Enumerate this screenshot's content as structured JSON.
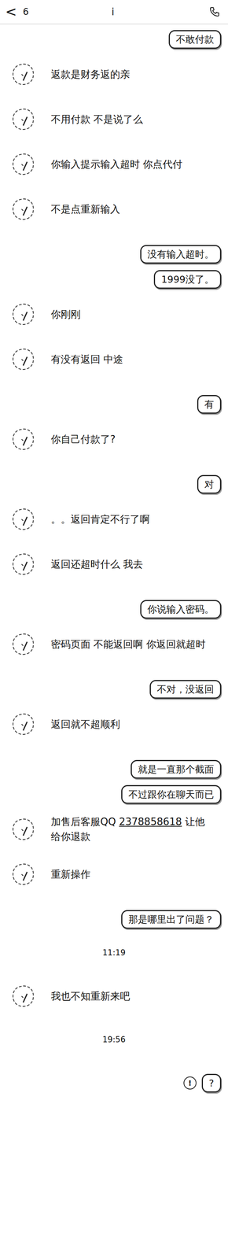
{
  "header": {
    "back": "<",
    "count": "6",
    "title": "i"
  },
  "messages": [
    {
      "kind": "sent",
      "text": "不敢付款"
    },
    {
      "kind": "received",
      "text": "返款是财务返的亲"
    },
    {
      "kind": "received",
      "text": "不用付款 不是说了么"
    },
    {
      "kind": "received",
      "text": "你输入提示输入超时 你点代付"
    },
    {
      "kind": "received",
      "text": "不是点重新输入"
    },
    {
      "kind": "sent",
      "text": "没有输入超时。"
    },
    {
      "kind": "sent",
      "text": "1999没了。"
    },
    {
      "kind": "received",
      "text": "你刚刚"
    },
    {
      "kind": "received",
      "text": "有没有返回 中途"
    },
    {
      "kind": "sent",
      "text": "有"
    },
    {
      "kind": "received",
      "text": "你自己付款了?"
    },
    {
      "kind": "sent",
      "text": "对"
    },
    {
      "kind": "received",
      "text": "。。返回肯定不行了啊"
    },
    {
      "kind": "received",
      "text": "返回还超时什么 我去"
    },
    {
      "kind": "sent",
      "text": "你说输入密码。"
    },
    {
      "kind": "received",
      "text": "密码页面 不能返回啊 你返回就超时"
    },
    {
      "kind": "sent",
      "text": "不对，没返回"
    },
    {
      "kind": "received",
      "text": "返回就不超顺利"
    },
    {
      "kind": "sent",
      "text": "就是一直那个截面"
    },
    {
      "kind": "sent",
      "text": "不过跟你在聊天而已"
    },
    {
      "kind": "received",
      "segments": [
        {
          "text": "加售后客服QQ ",
          "link": false
        },
        {
          "text": "2378858618",
          "link": true
        },
        {
          "text": " 让他给你退款",
          "link": false
        }
      ]
    },
    {
      "kind": "received",
      "text": "重新操作"
    },
    {
      "kind": "sent",
      "text": "那是哪里出了问题？"
    },
    {
      "kind": "time",
      "text": "11:19"
    },
    {
      "kind": "received",
      "text": "我也不知重新来吧"
    },
    {
      "kind": "time",
      "text": "19:56"
    },
    {
      "kind": "sent",
      "text": "?",
      "mark": "!"
    }
  ]
}
